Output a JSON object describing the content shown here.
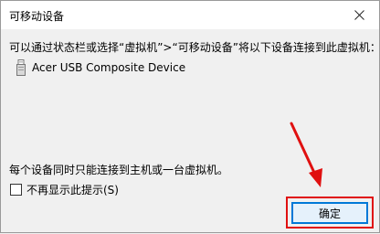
{
  "window": {
    "title": "可移动设备",
    "close_icon": "close-icon"
  },
  "content": {
    "intro_text": "可以通过状态栏或选择“虚拟机”>“可移动设备”将以下设备连接到此虚拟机：",
    "device": {
      "icon": "usb-icon",
      "label": "Acer USB Composite Device"
    },
    "note_text": "每个设备同时只能连接到主机或一台虚拟机。",
    "checkbox": {
      "label": "不再显示此提示(S)",
      "checked": false
    },
    "ok_button_label": "确定"
  },
  "annotation": {
    "color": "#e01010"
  }
}
